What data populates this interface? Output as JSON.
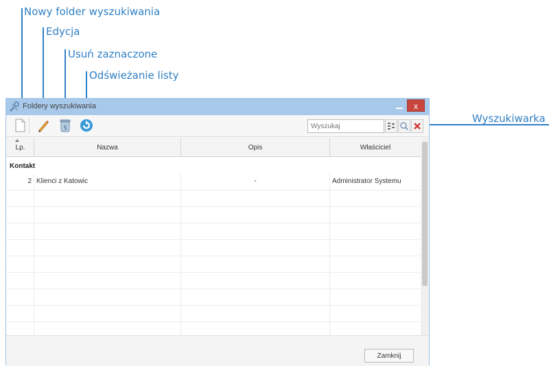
{
  "callouts": {
    "new_folder": "Nowy folder wyszukiwania",
    "edit": "Edycja",
    "delete_selected": "Usuń zaznaczone",
    "refresh": "Odświeżanie listy",
    "search_engine": "Wyszukiwarka"
  },
  "window": {
    "title": "Foldery wyszukiwania",
    "close_glyph": "x"
  },
  "toolbar": {
    "search_placeholder": "Wyszukaj",
    "search_value": "Wyszukaj"
  },
  "grid": {
    "columns": [
      "Lp.",
      "Nazwa",
      "Opis",
      "Właściciel"
    ],
    "group": "Kontakt",
    "rows": [
      {
        "lp": "2",
        "nazwa": "Klienci z Katowic",
        "opis": "-",
        "wlasciciel": "Administrator Systemu"
      }
    ]
  },
  "footer": {
    "close_label": "Zamknij"
  },
  "colors": {
    "accent": "#2f7fc4",
    "titlebar": "#a8c9ea",
    "close": "#c9463d"
  },
  "icons": [
    "new-document-icon",
    "pencil-icon",
    "trash-icon",
    "refresh-icon",
    "filter-icon",
    "magnifier-icon",
    "clear-icon",
    "tools-icon"
  ]
}
